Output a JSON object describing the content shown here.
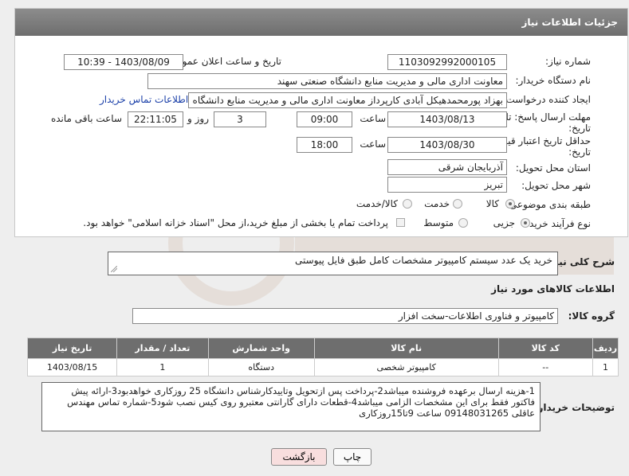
{
  "header": {
    "title": "جزئیات اطلاعات نیاز"
  },
  "fields": {
    "need_number_label": "شماره نیاز:",
    "need_number": "1103092992000105",
    "announce_label": "تاریخ و ساعت اعلان عمومی:",
    "announce_value": "1403/08/09 - 10:39",
    "buyer_org_label": "نام دستگاه خریدار:",
    "buyer_org": "معاونت اداری  مالی و مدیریت منابع دانشگاه صنعتی سهند",
    "requester_label": "ایجاد کننده درخواست:",
    "requester": "بهزاد پورمحمدهیکل آبادی کارپرداز معاونت اداری  مالی و مدیریت منابع دانشگاه ص",
    "contact_link": "اطلاعات تماس خریدار",
    "deadline_label_1": "مهلت ارسال پاسخ: تا",
    "deadline_label_2": "تاریخ:",
    "deadline_date": "1403/08/13",
    "time_label": "ساعت",
    "deadline_time": "09:00",
    "days_value": "3",
    "days_label": "روز و",
    "remaining_time": "22:11:05",
    "remaining_label": "ساعت باقی مانده",
    "price_valid_label_1": "حداقل تاریخ اعتبار قیمت: تا",
    "price_valid_label_2": "تاریخ:",
    "price_valid_date": "1403/08/30",
    "price_valid_time": "18:00",
    "province_label": "استان محل تحویل:",
    "province": "آذربایجان شرقی",
    "city_label": "شهر محل تحویل:",
    "city": "تبریز",
    "category_label": "طبقه بندی موضوعی:",
    "category_options": [
      "کالا",
      "خدمت",
      "کالا/خدمت"
    ],
    "process_label": "نوع فرآیند خرید :",
    "process_options": [
      "جزیی",
      "متوسط"
    ],
    "payment_note": "پرداخت تمام یا بخشی از مبلغ خرید،از محل \"اسناد خزانه اسلامی\" خواهد بود."
  },
  "summary": {
    "label": "شرح کلی نیاز:",
    "value": "خرید یک عدد سیستم کامپیوتر مشخصات کامل طبق فایل پیوستی"
  },
  "goods": {
    "section_title": "اطلاعات کالاهای مورد نیاز",
    "group_label": "گروه کالا:",
    "group_value": "کامپیوتر و فناوری اطلاعات-سخت افزار",
    "columns": [
      "ردیف",
      "کد کالا",
      "نام کالا",
      "واحد شمارش",
      "تعداد / مقدار",
      "تاریخ نیاز"
    ],
    "rows": [
      {
        "row": "1",
        "code": "--",
        "name": "کامپیوتر شخصی",
        "unit": "دستگاه",
        "qty": "1",
        "date": "1403/08/15"
      }
    ]
  },
  "buyer_notes": {
    "label": "توضیحات خریدار:",
    "lines": [
      "1-هزینه ارسال برعهده فروشنده میباشد2-پرداخت پس ازتحویل وتاییدکارشناس دانشگاه 25 روزکاری خواهدبود3-ارائه پیش",
      "فاکتور فقط برای این مشخصات الزامی میباشد4-قطعات دارای گارانتی معتبرو روی کیس نصب شود5-شماره تماس مهندس",
      "عاقلی 09148031265 ساعت 9تا15روزکاری"
    ]
  },
  "buttons": {
    "print": "چاپ",
    "back": "بازگشت"
  },
  "colors": {
    "header": "#6e6e6e",
    "link": "#1a3fa8",
    "back_btn": "#f8dede"
  }
}
